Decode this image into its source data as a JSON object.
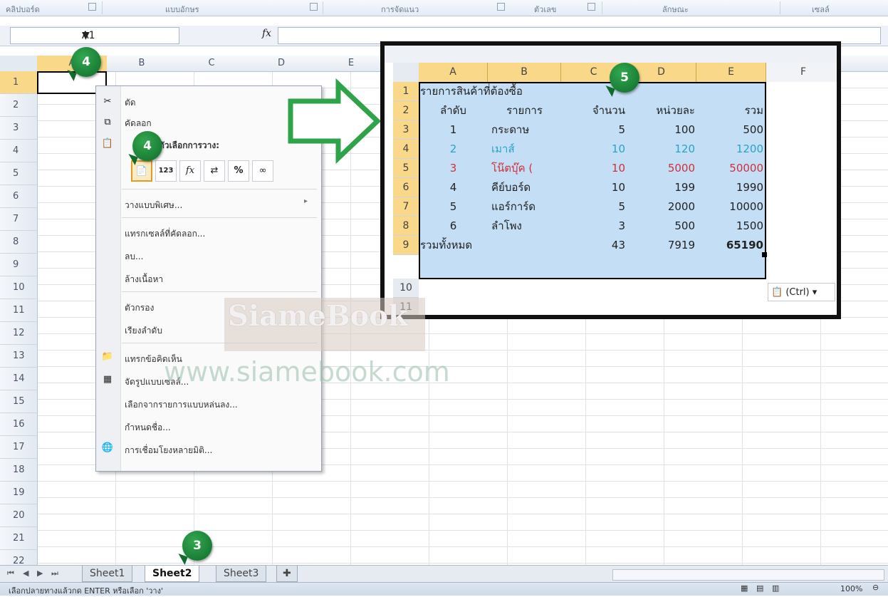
{
  "ribbon": {
    "groups": [
      "คลิปบอร์ด",
      "แบบอักษร",
      "การจัดแนว",
      "ตัวเลข",
      "ลักษณะ",
      "เซลล์"
    ]
  },
  "formula_bar": {
    "name_box": "A1",
    "fx_label": "fx",
    "content": ""
  },
  "grid": {
    "columns": [
      "A",
      "B",
      "C",
      "D",
      "E"
    ],
    "rows": [
      "1",
      "2",
      "3",
      "4",
      "5",
      "6",
      "7",
      "8",
      "9",
      "10",
      "11",
      "12",
      "13",
      "14",
      "15",
      "16",
      "17",
      "18",
      "19",
      "20",
      "21",
      "22"
    ]
  },
  "context_menu": {
    "cut": "ตัด",
    "copy": "คัดลอก",
    "paste_options_header": "ตัวเลือกการวาง:",
    "paste_icons": [
      "paste-icon",
      "values-icon",
      "formulas-icon",
      "transpose-icon",
      "formatting-icon",
      "paste-link-icon"
    ],
    "paste_special": "วางแบบพิเศษ...",
    "insert_copied_cells": "แทรกเซลล์ที่คัดลอก...",
    "delete": "ลบ...",
    "clear_contents": "ล้างเนื้อหา",
    "filter": "ตัวกรอง",
    "sort": "เรียงลำดับ",
    "insert_comment": "แทรกข้อคิดเห็น",
    "format_cells": "จัดรูปแบบเซลล์...",
    "pick_from_list": "เลือกจากรายการแบบหล่นลง...",
    "define_name": "กำหนดชื่อ...",
    "hyperlink": "การเชื่อมโยงหลายมิติ..."
  },
  "badges": {
    "row_header_badge": "4",
    "paste_badge": "4",
    "sheet_badge": "3",
    "result_badge": "5"
  },
  "result_sheet": {
    "columns": [
      "A",
      "B",
      "C",
      "D",
      "E",
      "F"
    ],
    "rows": [
      "1",
      "2",
      "3",
      "4",
      "5",
      "6",
      "7",
      "8",
      "9",
      "10",
      "11"
    ],
    "title": "รายการสินค้าที่ต้องซื้อ",
    "headers": [
      "ลำดับ",
      "รายการ",
      "จำนวน",
      "หน่วยละ",
      "รวม"
    ],
    "items": [
      {
        "no": "1",
        "name": "กระดาษ",
        "qty": "5",
        "unit": "100",
        "total": "500",
        "color": "#000000"
      },
      {
        "no": "2",
        "name": "เมาส์",
        "qty": "10",
        "unit": "120",
        "total": "1200",
        "color": "#2aa3c8"
      },
      {
        "no": "3",
        "name": "โน๊ตบุ๊ค  (",
        "qty": "10",
        "unit": "5000",
        "total": "50000",
        "color": "#d0303a"
      },
      {
        "no": "4",
        "name": "คีย์บอร์ด",
        "qty": "10",
        "unit": "199",
        "total": "1990",
        "color": "#000000"
      },
      {
        "no": "5",
        "name": "แอร์การ์ด",
        "qty": "5",
        "unit": "2000",
        "total": "10000",
        "color": "#000000"
      },
      {
        "no": "6",
        "name": "ลำโพง",
        "qty": "3",
        "unit": "500",
        "total": "1500",
        "color": "#000000"
      }
    ],
    "total_label": "รวมทั้งหมด",
    "total_qty": "43",
    "total_unit": "7919",
    "total_sum": "65190",
    "paste_ctrl": "(Ctrl) ▾"
  },
  "watermark": {
    "title": "SiameBook",
    "url": "www.siamebook.com"
  },
  "sheets": {
    "tabs": [
      "Sheet1",
      "Sheet2",
      "Sheet3"
    ],
    "active": "Sheet2"
  },
  "status": {
    "message": "เลือกปลายทางแล้วกด ENTER หรือเลือก 'วาง'",
    "zoom": "100%"
  },
  "colors": {
    "selected_header": "#f9d889",
    "table_fill": "#c3def5",
    "badge_green": "#1f8a3f",
    "arrow_green": "#2ea34a"
  }
}
